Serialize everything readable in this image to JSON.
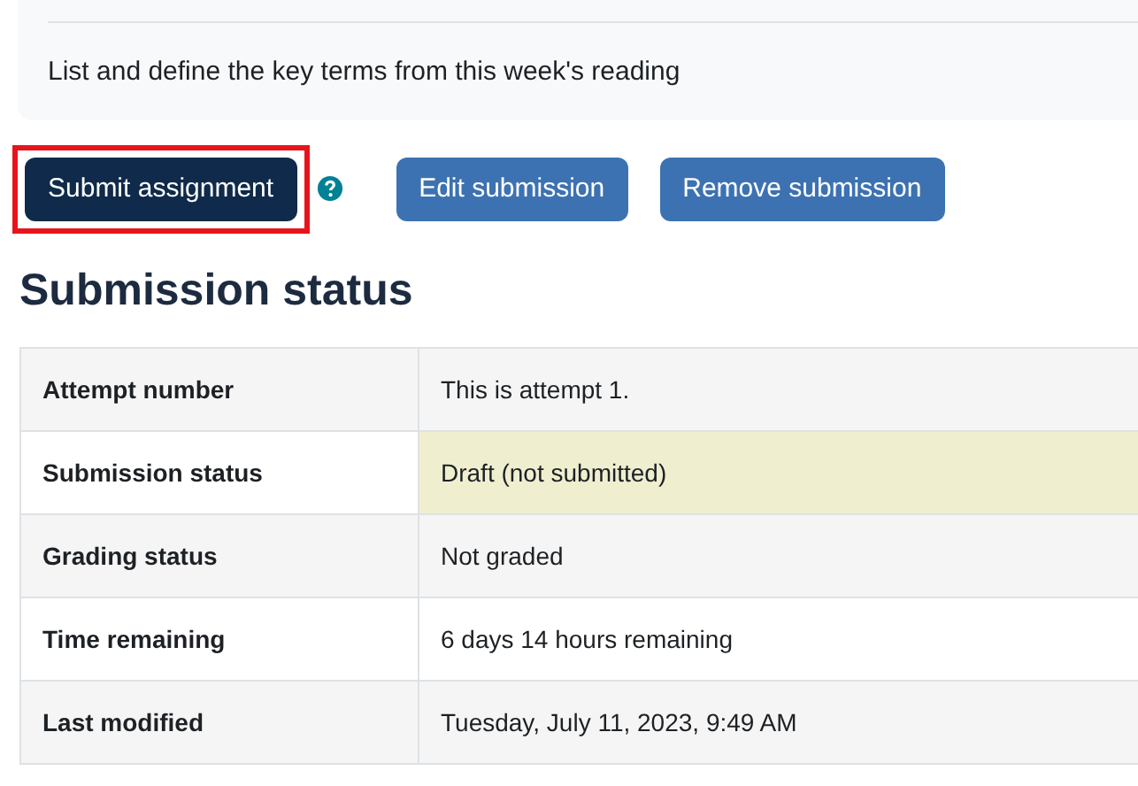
{
  "intro": {
    "text": "List and define the key terms from this week's reading"
  },
  "actions": [
    {
      "label": "Submit assignment",
      "kind": "primary",
      "highlighted": true,
      "help": true
    },
    {
      "label": "Edit submission",
      "kind": "secondary",
      "highlighted": false,
      "help": false
    },
    {
      "label": "Remove submission",
      "kind": "secondary",
      "highlighted": false,
      "help": false
    }
  ],
  "heading": "Submission status",
  "table": {
    "rows": [
      {
        "label": "Attempt number",
        "value": "This is attempt 1.",
        "highlighted": false
      },
      {
        "label": "Submission status",
        "value": "Draft (not submitted)",
        "highlighted": true
      },
      {
        "label": "Grading status",
        "value": "Not graded",
        "highlighted": false
      },
      {
        "label": "Time remaining",
        "value": "6 days 14 hours remaining",
        "highlighted": false
      },
      {
        "label": "Last modified",
        "value": "Tuesday, July 11, 2023, 9:49 AM",
        "highlighted": false
      }
    ]
  }
}
